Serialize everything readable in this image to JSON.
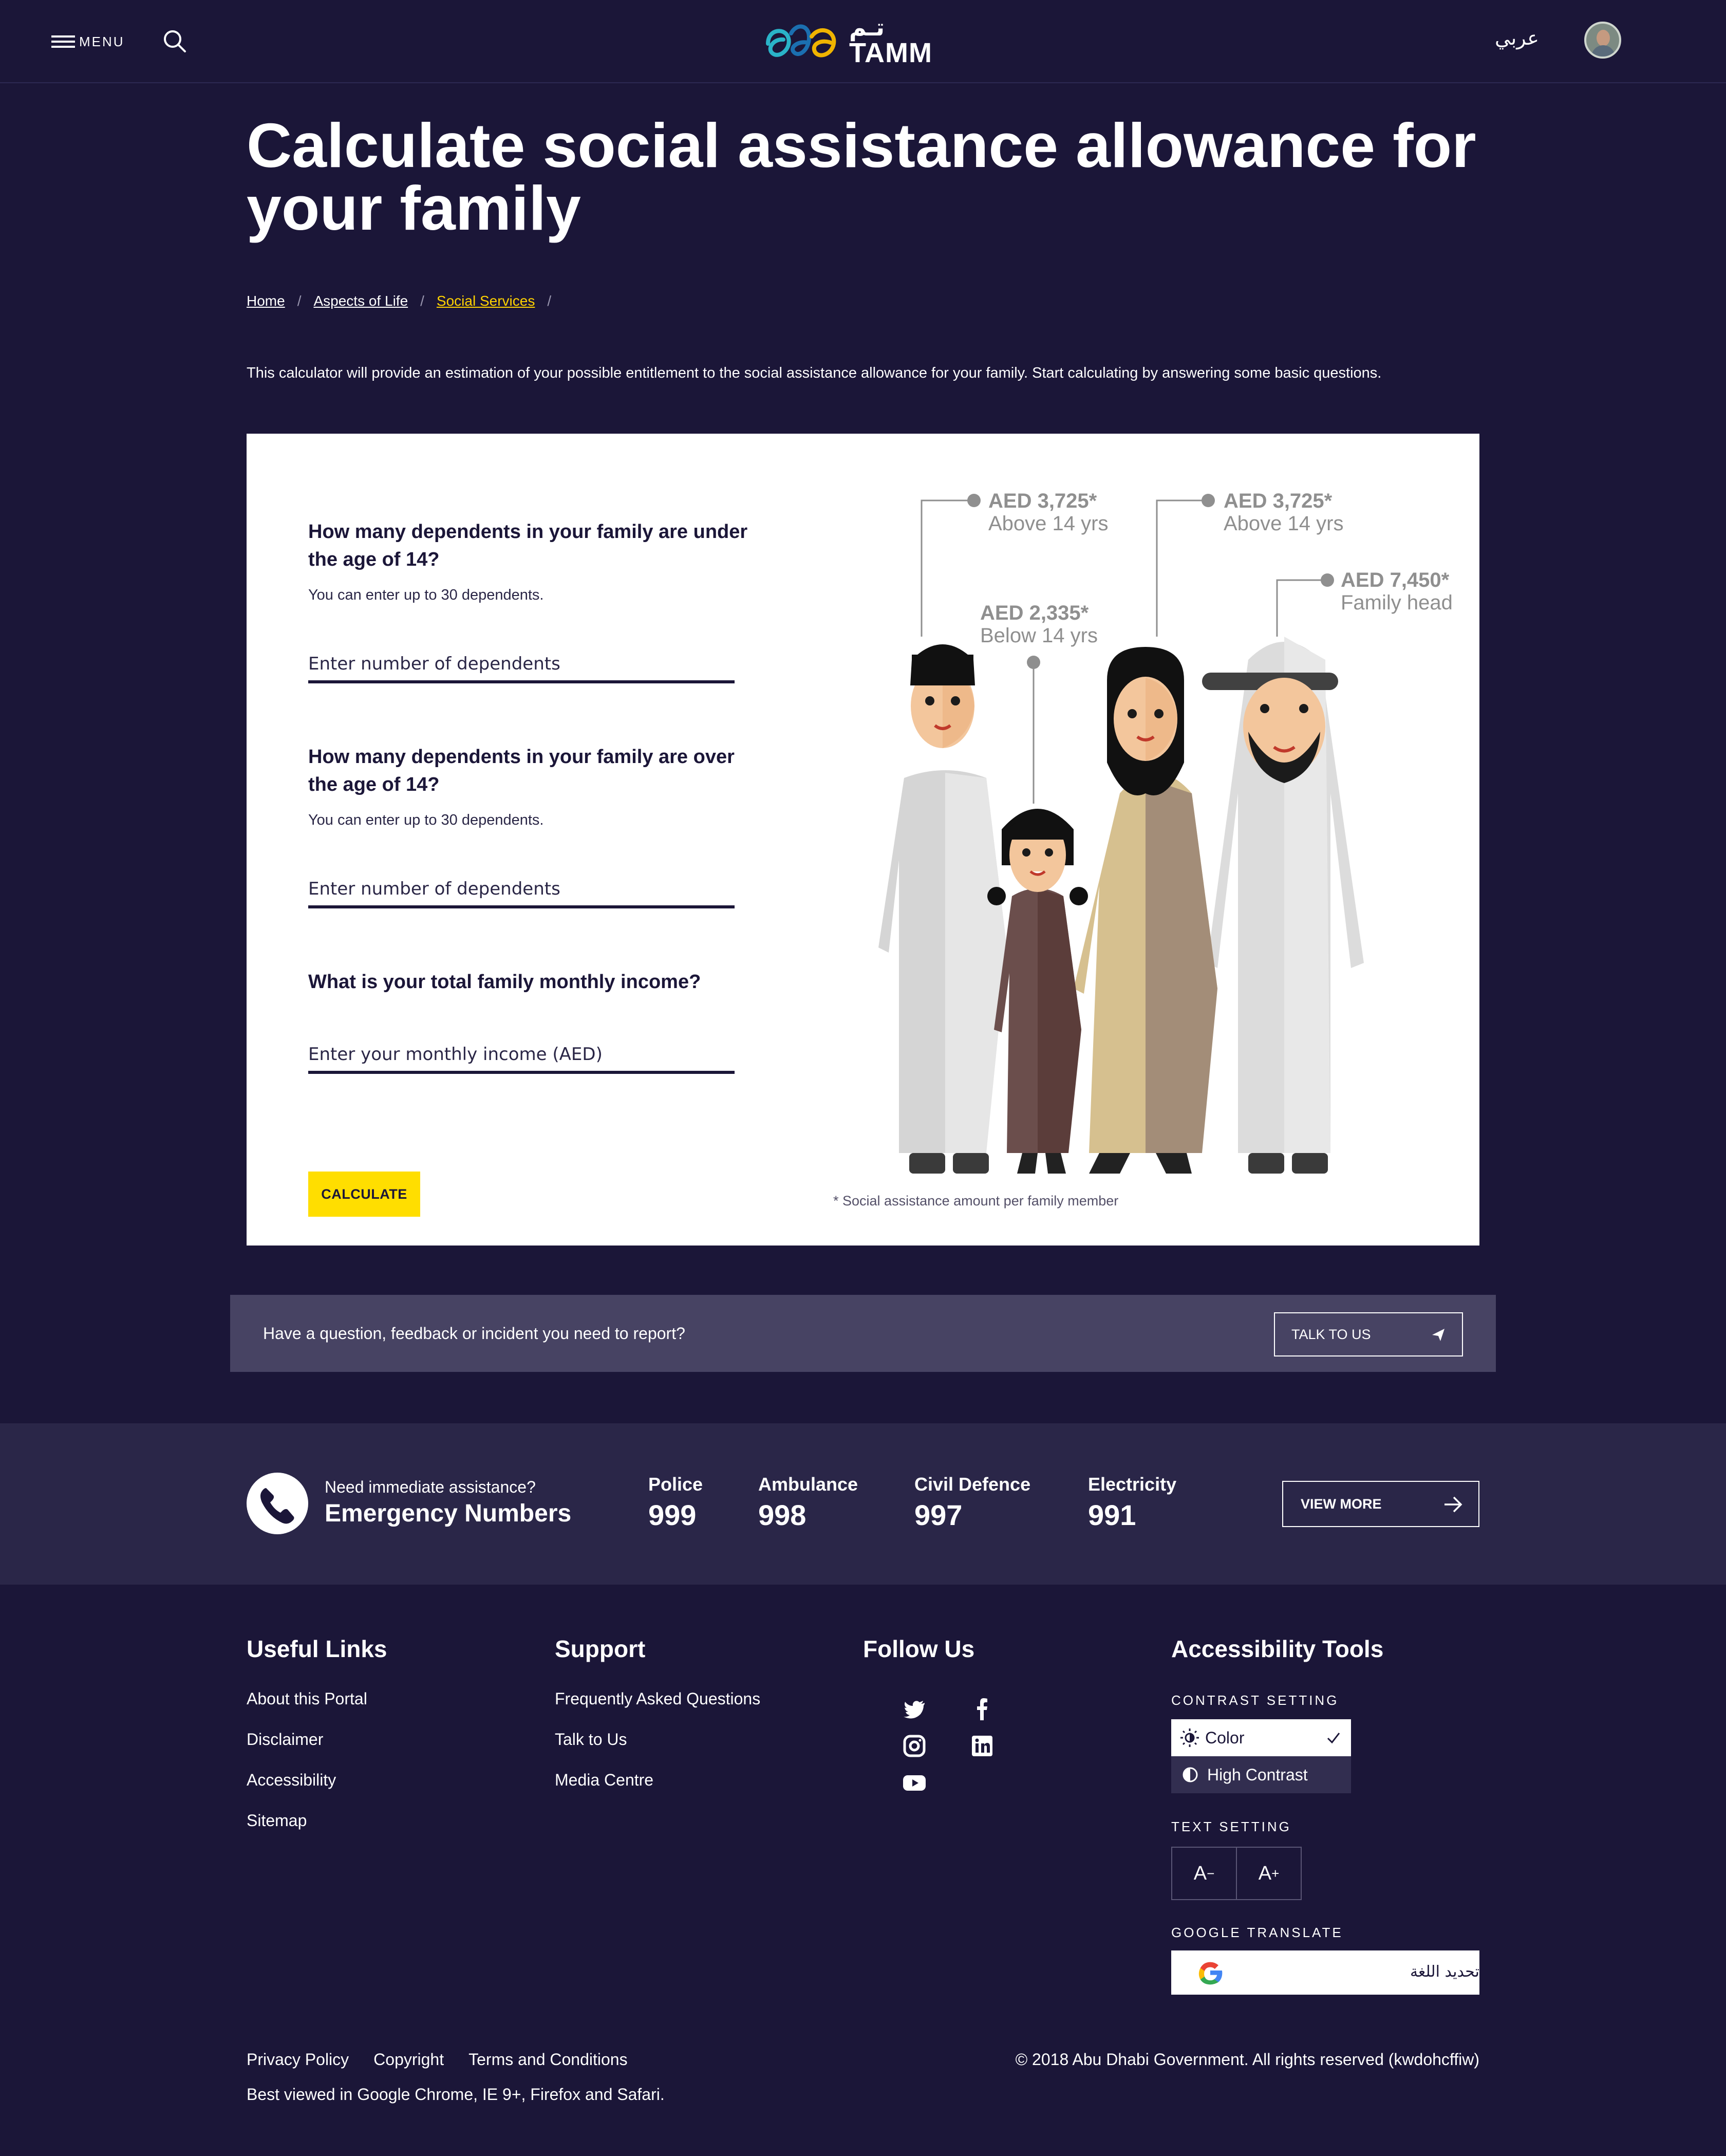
{
  "header": {
    "menu_label": "MENU",
    "logo_ar": "تـم",
    "logo_en": "TAMM",
    "language_link": "عربي"
  },
  "page": {
    "title": "Calculate social assistance allowance for your family",
    "breadcrumb": [
      "Home",
      "Aspects of Life",
      "Social Services"
    ],
    "intro": "This calculator will provide an estimation of your possible entitlement to the social assistance allowance for your family. Start calculating by answering some basic questions."
  },
  "calculator": {
    "q1": "How many dependents in your family are under the age of 14?",
    "q1_hint": "You can enter up to 30 dependents.",
    "q1_placeholder": "Enter number of dependents",
    "q2": "How many dependents in your family are over the age of 14?",
    "q2_hint": "You can enter up to 30 dependents.",
    "q2_placeholder": "Enter number of dependents",
    "q3": "What is your total family monthly income?",
    "q3_placeholder": "Enter your monthly income (AED)",
    "button": "CALCULATE",
    "labels": [
      {
        "amount": "AED 3,725*",
        "desc": "Above 14 yrs"
      },
      {
        "amount": "AED 2,335*",
        "desc": "Below 14 yrs"
      },
      {
        "amount": "AED 3,725*",
        "desc": "Above 14 yrs"
      },
      {
        "amount": "AED 7,450*",
        "desc": "Family head"
      }
    ],
    "footnote": "* Social assistance amount per family member"
  },
  "feedback": {
    "text": "Have a question, feedback or incident you need to report?",
    "button": "TALK TO US"
  },
  "emergency": {
    "question": "Need immediate assistance?",
    "title": "Emergency Numbers",
    "numbers": [
      {
        "label": "Police",
        "value": "999"
      },
      {
        "label": "Ambulance",
        "value": "998"
      },
      {
        "label": "Civil Defence",
        "value": "997"
      },
      {
        "label": "Electricity",
        "value": "991"
      }
    ],
    "button": "VIEW MORE"
  },
  "footer": {
    "useful_links": {
      "title": "Useful Links",
      "items": [
        "About this Portal",
        "Disclaimer",
        "Accessibility",
        "Sitemap"
      ]
    },
    "support": {
      "title": "Support",
      "items": [
        "Frequently Asked Questions",
        "Talk to Us",
        "Media Centre"
      ]
    },
    "follow": {
      "title": "Follow Us",
      "icons": [
        "twitter-icon",
        "facebook-icon",
        "instagram-icon",
        "linkedin-icon",
        "youtube-icon"
      ]
    },
    "accessibility": {
      "title": "Accessibility Tools",
      "contrast_label": "CONTRAST SETTING",
      "contrast_options": [
        "Color",
        "High Contrast"
      ],
      "text_label": "TEXT SETTING",
      "text_decrease": "A",
      "text_increase": "A",
      "translate_label": "GOOGLE TRANSLATE",
      "translate_text": "تحديد اللغة"
    },
    "legal_links": [
      "Privacy Policy",
      "Copyright",
      "Terms and Conditions"
    ],
    "browsers": "Best viewed in Google Chrome, IE 9+, Firefox and Safari.",
    "copyright": "© 2018 Abu Dhabi Government. All rights reserved (kwdohcffiw)"
  },
  "colors": {
    "background": "#1b1638",
    "accent": "#ffde00",
    "breadcrumb_current": "#ffd200",
    "bar": "#474363",
    "emergency_band": "#2a2648"
  }
}
